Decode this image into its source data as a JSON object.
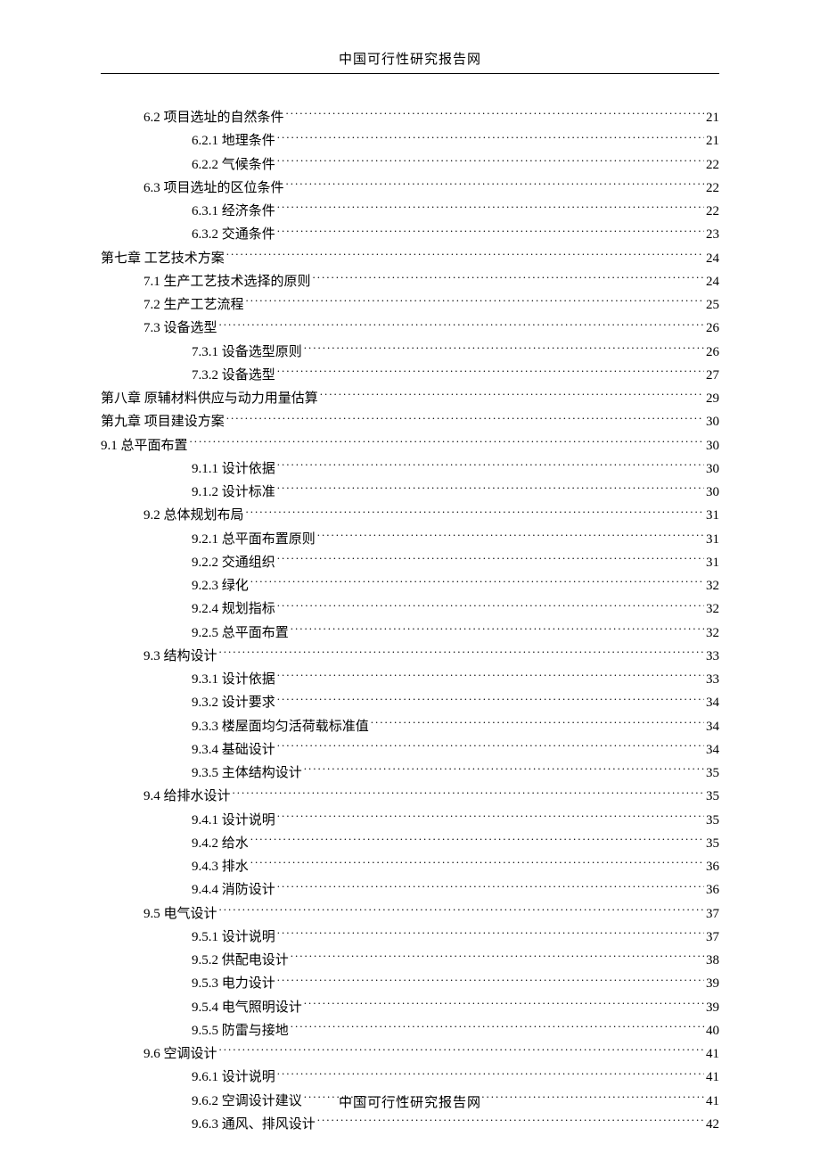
{
  "header": "中国可行性研究报告网",
  "footer": "中国可行性研究报告网",
  "toc": [
    {
      "level": 1,
      "label": "6.2 项目选址的自然条件",
      "page": "21"
    },
    {
      "level": 2,
      "label": "6.2.1 地理条件",
      "page": "21"
    },
    {
      "level": 2,
      "label": "6.2.2 气候条件",
      "page": "22"
    },
    {
      "level": 1,
      "label": "6.3 项目选址的区位条件",
      "page": "22"
    },
    {
      "level": 2,
      "label": "6.3.1 经济条件",
      "page": "22"
    },
    {
      "level": 2,
      "label": "6.3.2 交通条件",
      "page": "23"
    },
    {
      "level": 0,
      "label": "第七章 工艺技术方案",
      "page": "24"
    },
    {
      "level": 1,
      "label": "7.1 生产工艺技术选择的原则",
      "page": "24"
    },
    {
      "level": 1,
      "label": "7.2  生产工艺流程",
      "page": "25"
    },
    {
      "level": 1,
      "label": "7.3 设备选型",
      "page": "26"
    },
    {
      "level": 2,
      "label": "7.3.1 设备选型原则",
      "page": "26"
    },
    {
      "level": 2,
      "label": "7.3.2 设备选型",
      "page": "27"
    },
    {
      "level": 0,
      "label": "第八章 原辅材料供应与动力用量估算",
      "page": "29"
    },
    {
      "level": 0,
      "label": "第九章 项目建设方案",
      "page": "30"
    },
    {
      "level": "1b",
      "label": "9.1 总平面布置",
      "page": "30"
    },
    {
      "level": 2,
      "label": "9.1.1 设计依据",
      "page": "30"
    },
    {
      "level": 2,
      "label": "9.1.2 设计标准",
      "page": "30"
    },
    {
      "level": 1,
      "label": "9.2 总体规划布局",
      "page": "31"
    },
    {
      "level": 2,
      "label": "9.2.1 总平面布置原则",
      "page": "31"
    },
    {
      "level": 2,
      "label": "9.2.2 交通组织",
      "page": "31"
    },
    {
      "level": 2,
      "label": "9.2.3 绿化",
      "page": "32"
    },
    {
      "level": 2,
      "label": "9.2.4 规划指标",
      "page": "32"
    },
    {
      "level": 2,
      "label": "9.2.5 总平面布置",
      "page": "32"
    },
    {
      "level": 1,
      "label": "9.3 结构设计",
      "page": "33"
    },
    {
      "level": 2,
      "label": "9.3.1 设计依据",
      "page": "33"
    },
    {
      "level": 2,
      "label": "9.3.2 设计要求",
      "page": "34"
    },
    {
      "level": 2,
      "label": "9.3.3 楼屋面均匀活荷载标准值",
      "page": "34"
    },
    {
      "level": 2,
      "label": "9.3.4 基础设计",
      "page": "34"
    },
    {
      "level": 2,
      "label": "9.3.5 主体结构设计",
      "page": "35"
    },
    {
      "level": 1,
      "label": "9.4 给排水设计",
      "page": "35"
    },
    {
      "level": 2,
      "label": "9.4.1 设计说明",
      "page": "35"
    },
    {
      "level": 2,
      "label": "9.4.2 给水",
      "page": "35"
    },
    {
      "level": 2,
      "label": "9.4.3 排水",
      "page": "36"
    },
    {
      "level": 2,
      "label": "9.4.4 消防设计",
      "page": "36"
    },
    {
      "level": 1,
      "label": "9.5 电气设计",
      "page": "37"
    },
    {
      "level": 2,
      "label": "9.5.1 设计说明",
      "page": "37"
    },
    {
      "level": 2,
      "label": "9.5.2 供配电设计",
      "page": "38"
    },
    {
      "level": 2,
      "label": "9.5.3 电力设计",
      "page": "39"
    },
    {
      "level": 2,
      "label": "9.5.4 电气照明设计",
      "page": "39"
    },
    {
      "level": 2,
      "label": "9.5.5 防雷与接地",
      "page": "40"
    },
    {
      "level": 1,
      "label": "9.6 空调设计",
      "page": "41"
    },
    {
      "level": 2,
      "label": "9.6.1 设计说明",
      "page": "41"
    },
    {
      "level": 2,
      "label": "9.6.2 空调设计建议",
      "page": "41"
    },
    {
      "level": 2,
      "label": "9.6.3 通风、排风设计",
      "page": "42"
    }
  ]
}
